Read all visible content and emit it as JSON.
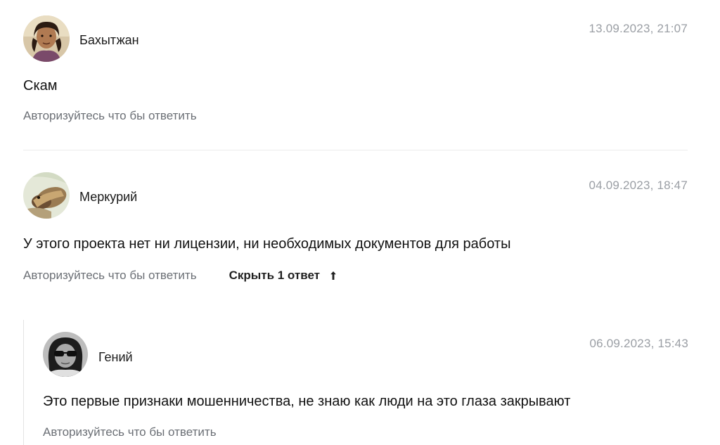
{
  "comments": [
    {
      "author": "Бахытжан",
      "date": "13.09.2023, 21:07",
      "text": "Скам",
      "reply_link": "Авторизуйтесь что бы ответить"
    },
    {
      "author": "Меркурий",
      "date": "04.09.2023, 18:47",
      "text": "У этого проекта нет ни лицензии, ни необходимых документов для работы",
      "reply_link": "Авторизуйтесь что бы ответить",
      "toggle_replies": "Скрыть 1 ответ",
      "replies": [
        {
          "author": "Гений",
          "date": "06.09.2023, 15:43",
          "text": "Это первые признаки мошенничества, не знаю как люди на это глаза закрывают",
          "reply_link": "Авторизуйтесь что бы ответить"
        }
      ]
    }
  ],
  "colors": {
    "date": "#9a9ea4",
    "muted_link": "#6b6f75",
    "divider": "#ececec",
    "thread_line": "#e3e3e3"
  },
  "icons": {
    "toggle": "arrow-up-icon"
  }
}
